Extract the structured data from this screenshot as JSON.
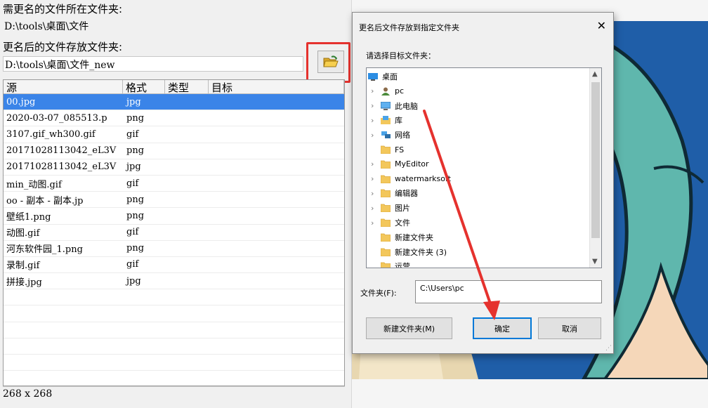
{
  "left_panel": {
    "source_label": "需更名的文件所在文件夹:",
    "source_path": "D:\\tools\\桌面\\文件",
    "dest_label": "更名后的文件存放文件夹:",
    "dest_path": "D:\\tools\\桌面\\文件_new",
    "browse_icon": "open-folder-icon",
    "table": {
      "headers": [
        "源",
        "格式",
        "类型",
        "目标"
      ],
      "rows": [
        {
          "name": "00.jpg",
          "format": "jpg",
          "selected": true
        },
        {
          "name": "2020-03-07_085513.p",
          "format": "png"
        },
        {
          "name": "3107.gif_wh300.gif",
          "format": "gif"
        },
        {
          "name": "20171028113042_eL3V",
          "format": "png"
        },
        {
          "name": "20171028113042_eL3V",
          "format": "jpg"
        },
        {
          "name": "min_动图.gif",
          "format": "gif"
        },
        {
          "name": "oo - 副本 - 副本.jp",
          "format": "png"
        },
        {
          "name": "壁纸1.png",
          "format": "png"
        },
        {
          "name": "动图.gif",
          "format": "gif"
        },
        {
          "name": "河东软件园_1.png",
          "format": "png"
        },
        {
          "name": "录制.gif",
          "format": "gif"
        },
        {
          "name": "拼接.jpg",
          "format": "jpg"
        }
      ]
    },
    "image_size": "268 x 268"
  },
  "dialog": {
    "title": "更名后文件存放到指定文件夹",
    "close_glyph": "✕",
    "prompt": "请选择目标文件夹：",
    "tree": [
      {
        "label": "桌面",
        "icon": "desktop-icon",
        "expandable": false,
        "indent": 0
      },
      {
        "label": "pc",
        "icon": "user-icon",
        "expandable": true,
        "indent": 1
      },
      {
        "label": "此电脑",
        "icon": "computer-icon",
        "expandable": true,
        "indent": 1
      },
      {
        "label": "库",
        "icon": "library-icon",
        "expandable": true,
        "indent": 1
      },
      {
        "label": "网络",
        "icon": "network-icon",
        "expandable": true,
        "indent": 1
      },
      {
        "label": "FS",
        "icon": "folder-icon",
        "expandable": false,
        "indent": 1
      },
      {
        "label": "MyEditor",
        "icon": "folder-icon",
        "expandable": true,
        "indent": 1
      },
      {
        "label": "watermarksoft",
        "icon": "folder-icon",
        "expandable": true,
        "indent": 1
      },
      {
        "label": "编辑器",
        "icon": "folder-icon",
        "expandable": true,
        "indent": 1
      },
      {
        "label": "图片",
        "icon": "folder-icon",
        "expandable": true,
        "indent": 1
      },
      {
        "label": "文件",
        "icon": "folder-icon",
        "expandable": true,
        "indent": 1
      },
      {
        "label": "新建文件夹",
        "icon": "folder-icon",
        "expandable": false,
        "indent": 1
      },
      {
        "label": "新建文件夹 (3)",
        "icon": "folder-icon",
        "expandable": false,
        "indent": 1
      },
      {
        "label": "运营",
        "icon": "folder-icon",
        "expandable": false,
        "indent": 1
      }
    ],
    "folder_label": "文件夹(F):",
    "folder_value": "C:\\Users\\pc",
    "buttons": {
      "new_folder": "新建文件夹(M)",
      "ok": "确定",
      "cancel": "取消"
    }
  },
  "colors": {
    "selection": "#3a84e8",
    "annotation_red": "#e5322e",
    "ok_border": "#0078d7"
  }
}
